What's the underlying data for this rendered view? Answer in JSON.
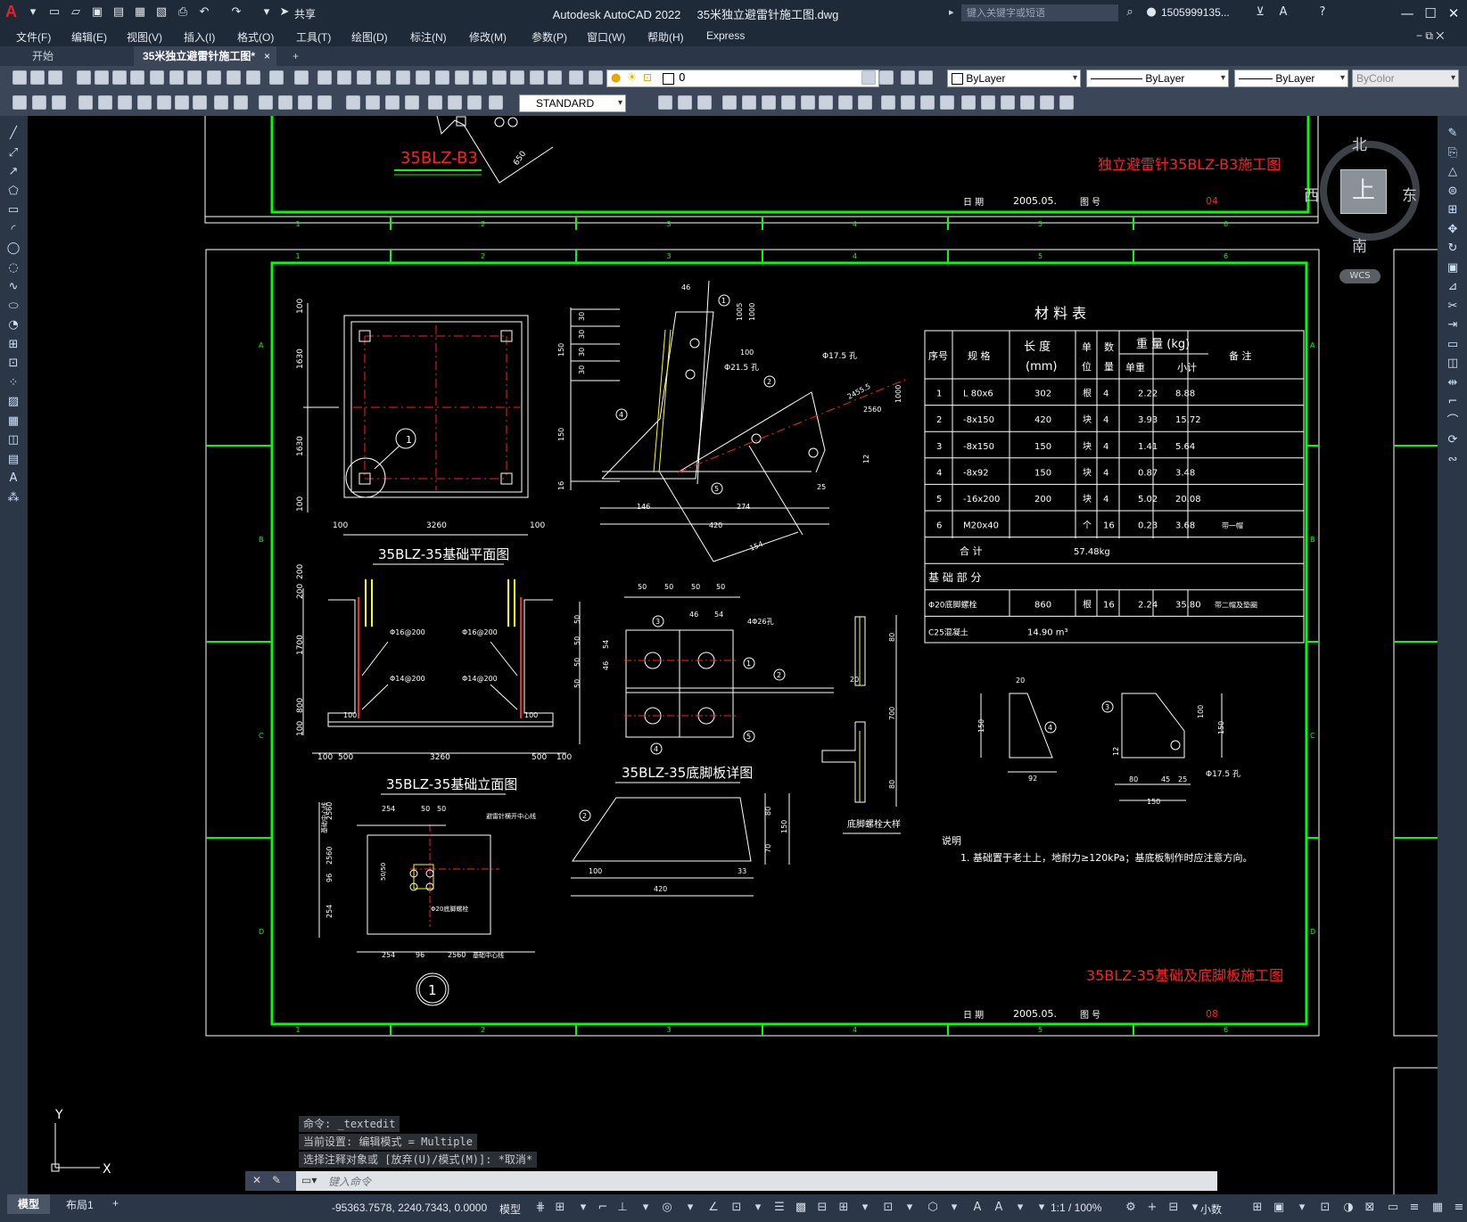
{
  "titlebar": {
    "app_title": "Autodesk AutoCAD 2022",
    "file_name": "35米独立避雷针施工图.dwg",
    "share_label": "共享",
    "search_placeholder": "键入关键字或短语",
    "user": "1505999135...",
    "logo": "A"
  },
  "menu": {
    "items": [
      "文件(F)",
      "编辑(E)",
      "视图(V)",
      "插入(I)",
      "格式(O)",
      "工具(T)",
      "绘图(D)",
      "标注(N)",
      "修改(M)",
      "参数(P)",
      "窗口(W)",
      "帮助(H)",
      "Express"
    ]
  },
  "tabs": {
    "start": "开始",
    "drawing": "35米独立避雷针施工图*",
    "close": "×",
    "add": "+"
  },
  "toolbar": {
    "layer_value": "0",
    "color": "ByLayer",
    "linetype": "ByLayer",
    "lineweight": "ByLayer",
    "plotstyle": "ByColor",
    "textstyle": "STANDARD"
  },
  "viewcube": {
    "north": "北",
    "south": "南",
    "east": "东",
    "west": "西",
    "top": "上",
    "wcs": "WCS"
  },
  "drawing": {
    "upper_sheet": {
      "label": "35BLZ-B3",
      "title": "独立避雷针35BLZ-B3施工图",
      "date_label": "日 期",
      "date": "2005.05.",
      "figno_label": "图 号",
      "figno": "04",
      "dim_650": "650"
    },
    "sheet": {
      "title": "35BLZ-35基础及底脚板施工图",
      "date_label": "日 期",
      "date": "2005.05.",
      "figno_label": "图 号",
      "figno": "08",
      "col_labels": [
        "1",
        "2",
        "3",
        "4",
        "5",
        "6"
      ],
      "row_labels": [
        "A",
        "B",
        "C",
        "D"
      ]
    },
    "views": {
      "plan_title": "35BLZ-35基础平面图",
      "elev_title": "35BLZ-35基础立面图",
      "plate_title": "35BLZ-35底脚板详图",
      "bolt_title": "底脚螺栓大样",
      "callout": "1"
    },
    "dims": {
      "plan_bottom": [
        "100",
        "3260",
        "100"
      ],
      "plan_left": [
        "100",
        "1630",
        "1630",
        "100"
      ],
      "elev_bottom": [
        "100",
        "500",
        "3260",
        "500",
        "100"
      ],
      "elev_left": [
        "200",
        "200",
        "1700",
        "800",
        "100"
      ],
      "rebar": [
        "Φ16@200",
        "Φ16@200",
        "Φ14@200",
        "Φ14@200",
        "100",
        "100"
      ],
      "gusset": [
        "46",
        "100",
        "Φ21.5 孔",
        "Φ17.5 孔",
        "2455.5",
        "2560",
        "1000",
        "1005",
        "1000",
        "150",
        "150",
        "30",
        "30",
        "30",
        "30",
        "12",
        "16",
        "25",
        "146",
        "274",
        "420",
        "154"
      ],
      "plate_top": [
        "50",
        "50",
        "50",
        "50"
      ],
      "plate_left": [
        "50",
        "50",
        "50",
        "50",
        "54",
        "46"
      ],
      "plate_misc": [
        "46",
        "54",
        "4Φ26孔",
        "20"
      ],
      "bottom": [
        "100",
        "33",
        "420",
        "80",
        "70",
        "150"
      ],
      "bolt": [
        "80",
        "700",
        "80"
      ],
      "loc": [
        "254",
        "50",
        "50",
        "254",
        "96",
        "2560",
        "2560",
        "96",
        "254",
        "50/50"
      ],
      "loc_notes": [
        "避雷针横开中心线",
        "Φ20底脚螺栓",
        "基础中心线",
        "基础中心线"
      ],
      "parts_a": [
        "20",
        "150",
        "92"
      ],
      "parts_b": [
        "100",
        "150",
        "12",
        "80",
        "45",
        "25",
        "150",
        "Φ17.5 孔"
      ]
    },
    "bom": {
      "title": "材 料 表",
      "headers": [
        "序号",
        "规 格",
        "长 度\n(mm)",
        "单\n位",
        "数\n量",
        "重 量 (kg)",
        "单重",
        "小计",
        "备 注"
      ],
      "rows": [
        [
          "1",
          "L 80x6",
          "302",
          "根",
          "4",
          "2.22",
          "8.88",
          ""
        ],
        [
          "2",
          "-8x150",
          "420",
          "块",
          "4",
          "3.93",
          "15.72",
          ""
        ],
        [
          "3",
          "-8x150",
          "150",
          "块",
          "4",
          "1.41",
          "5.64",
          ""
        ],
        [
          "4",
          "-8x92",
          "150",
          "块",
          "4",
          "0.87",
          "3.48",
          ""
        ],
        [
          "5",
          "-16x200",
          "200",
          "块",
          "4",
          "5.02",
          "20.08",
          ""
        ],
        [
          "6",
          "M20x40",
          "",
          "个",
          "16",
          "0.23",
          "3.68",
          "带一帽"
        ]
      ],
      "total_label": "合 计",
      "total": "57.48kg",
      "foundation_label": "基 础 部 分",
      "bolt_row": [
        "Φ20底脚螺栓",
        "860",
        "根",
        "16",
        "2.24",
        "35.80",
        "带二帽及垫圈"
      ],
      "concrete_row": [
        "C25混凝土",
        "14.90 m³"
      ]
    },
    "notes_title": "说明",
    "notes": "1. 基础置于老土上，地耐力≥120kPa；基底板制作时应注意方向。"
  },
  "command": {
    "history": [
      "命令: _textedit",
      "当前设置: 编辑模式 = Multiple",
      "选择注释对象或 [放弃(U)/模式(M)]: *取消*"
    ],
    "placeholder": "键入命令"
  },
  "ucs": {
    "x": "X",
    "y": "Y"
  },
  "status": {
    "model_tab": "模型",
    "layout_tab": "布局1",
    "coords": "-95363.7578, 2240.7343, 0.0000",
    "space": "模型",
    "scale": "1:1 / 100%",
    "units": "小数"
  },
  "colors": {
    "sheet_border": "#00ff00",
    "dim": "#ffffff",
    "red_text": "#ff2020",
    "yellow": "#ffff00",
    "ui_dark": "#2b3646"
  }
}
